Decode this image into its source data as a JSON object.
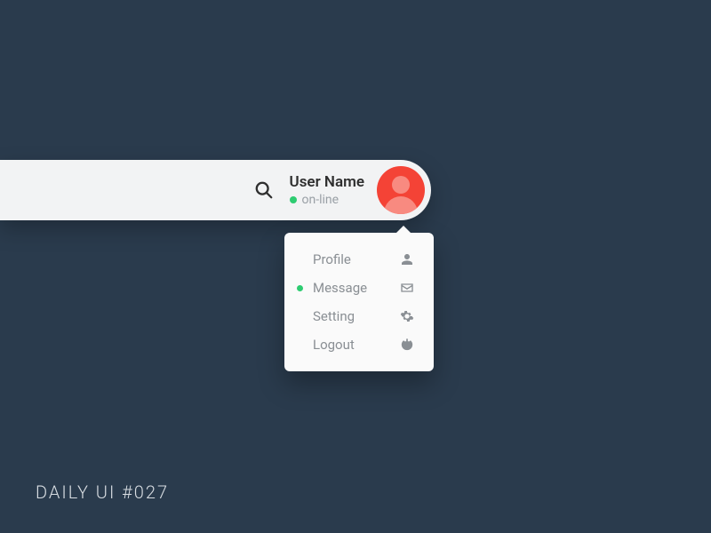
{
  "colors": {
    "background": "#2a3b4d",
    "surface": "#f2f3f4",
    "accent": "#f44336",
    "online": "#2ecc71",
    "muted": "#8a8f94"
  },
  "topbar": {
    "user_name": "User Name",
    "status_text": "on-line"
  },
  "dropdown": {
    "items": [
      {
        "label": "Profile",
        "icon": "user-icon",
        "badge": false
      },
      {
        "label": "Message",
        "icon": "envelope-icon",
        "badge": true
      },
      {
        "label": "Setting",
        "icon": "gear-icon",
        "badge": false
      },
      {
        "label": "Logout",
        "icon": "power-icon",
        "badge": false
      }
    ]
  },
  "caption": "DAILY UI #027"
}
